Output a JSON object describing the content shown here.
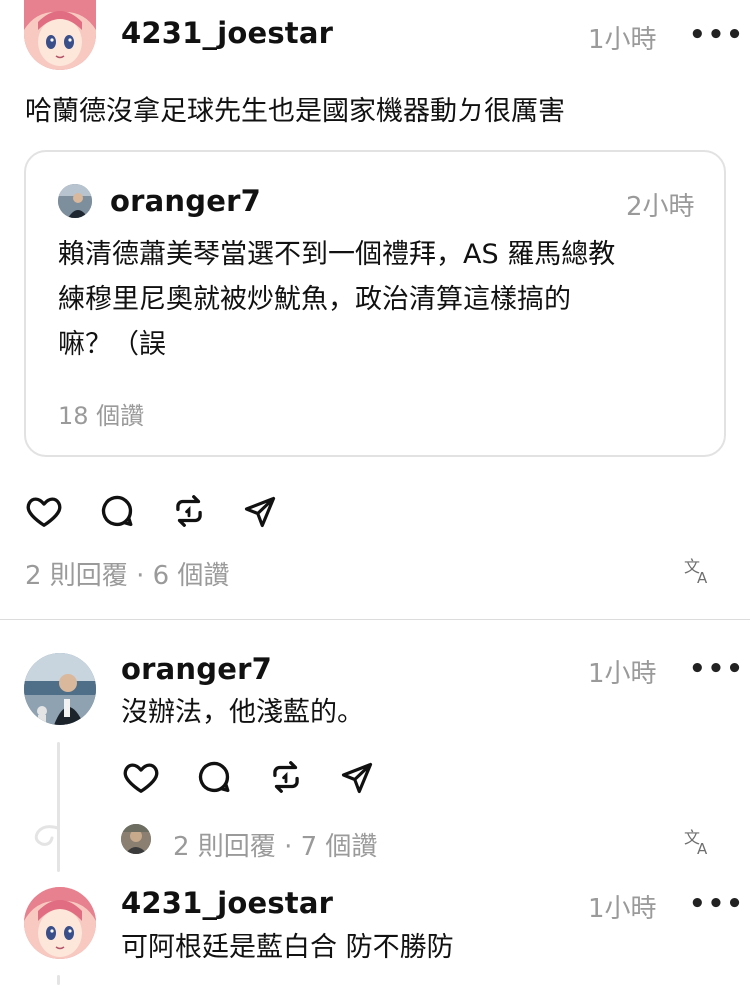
{
  "post": {
    "username": "4231_joestar",
    "time": "1小時",
    "more": "•••",
    "text": "哈蘭德沒拿足球先生也是國家機器動ㄉ很厲害",
    "quote": {
      "username": "oranger7",
      "time": "2小時",
      "text_lines": [
        "賴清德蕭美琴當選不到一個禮拜，AS 羅馬總教",
        "練穆里尼奧就被炒魷魚，政治清算這樣搞的",
        "嘛？（誤"
      ],
      "likes": "18 個讚"
    },
    "stats": "2 則回覆 · 6 個讚"
  },
  "reply1": {
    "username": "oranger7",
    "time": "1小時",
    "more": "•••",
    "text": "沒辦法，他淺藍的。",
    "stats": "2 則回覆 · 7 個讚"
  },
  "reply2": {
    "username": "4231_joestar",
    "time": "1小時",
    "more": "•••",
    "text": "可阿根廷是藍白合 防不勝防"
  },
  "icons": {
    "like": "heart-icon",
    "comment": "comment-icon",
    "repost": "repost-icon",
    "share": "send-icon",
    "translate": "translate-icon"
  },
  "colors": {
    "text": "#111111",
    "secondary": "#9a9a9a",
    "border": "#e2e2e2"
  }
}
